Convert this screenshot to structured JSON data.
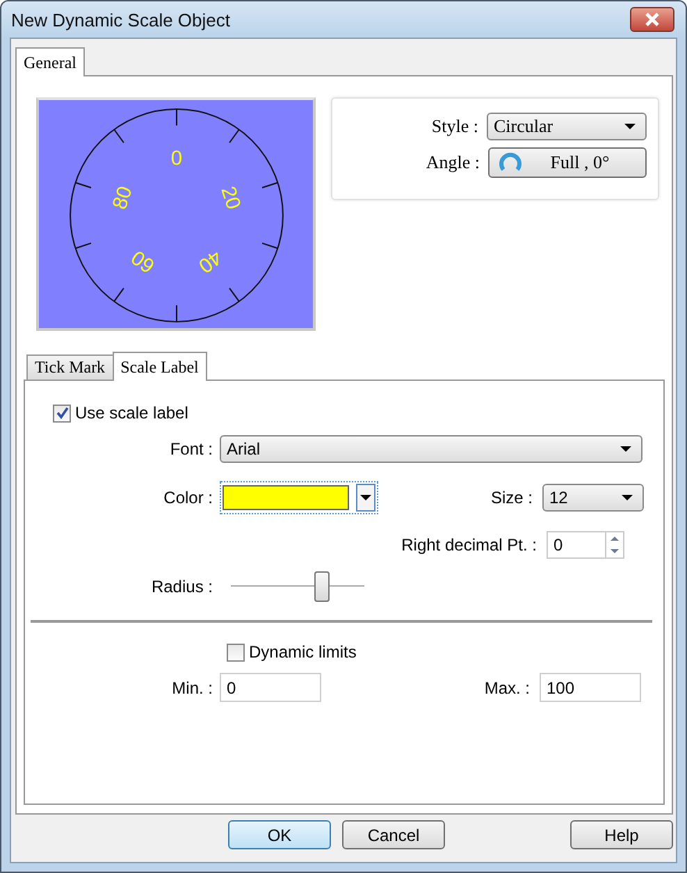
{
  "window": {
    "title": "New Dynamic Scale Object"
  },
  "outer_tabs": [
    {
      "label": "General",
      "selected": true
    }
  ],
  "preview": {
    "labels": [
      "0",
      "20",
      "40",
      "60",
      "80"
    ]
  },
  "style": {
    "label": "Style :",
    "value": "Circular"
  },
  "angle": {
    "label": "Angle :",
    "value": "Full , 0°"
  },
  "inner_tabs": [
    {
      "label": "Tick Mark",
      "selected": false
    },
    {
      "label": "Scale Label",
      "selected": true
    }
  ],
  "use_scale_label": {
    "label": "Use scale label",
    "checked": true
  },
  "font": {
    "label": "Font :",
    "value": "Arial"
  },
  "color": {
    "label": "Color :",
    "color": "#ffff00"
  },
  "size": {
    "label": "Size :",
    "value": "12"
  },
  "decimal": {
    "label": "Right decimal Pt. :",
    "value": "0"
  },
  "radius": {
    "label": "Radius :",
    "level": 0.68
  },
  "dynamic_limits": {
    "label": "Dynamic limits",
    "checked": false
  },
  "min": {
    "label": "Min. :",
    "value": "0"
  },
  "max": {
    "label": "Max. :",
    "value": "100"
  },
  "buttons": [
    {
      "label": "OK",
      "kind": "default"
    },
    {
      "label": "Cancel",
      "kind": "normal"
    },
    {
      "label": "Help",
      "kind": "normal"
    }
  ]
}
